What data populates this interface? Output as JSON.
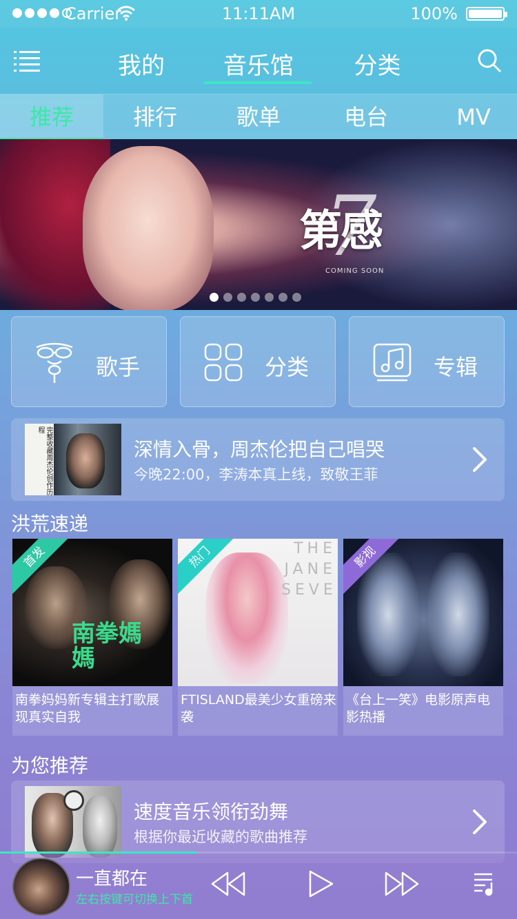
{
  "status_bar": {
    "carrier": "Carrier",
    "time": "11:11AM",
    "battery": "100%"
  },
  "top_nav": {
    "tabs": [
      "我的",
      "音乐馆",
      "分类"
    ],
    "active": 1
  },
  "sub_tabs": {
    "tabs": [
      "推荐",
      "排行",
      "歌单",
      "电台",
      "MV"
    ],
    "active": 0
  },
  "banner": {
    "title": "第7感",
    "title_text": "第感",
    "seven": "7",
    "subtitle": "COMING SOON",
    "pages": 7,
    "current_page": 0
  },
  "quick_links": [
    {
      "label": "歌手",
      "icon": "singer-icon"
    },
    {
      "label": "分类",
      "icon": "category-grid-icon"
    },
    {
      "label": "专辑",
      "icon": "album-icon"
    }
  ],
  "promo": {
    "title": "深情入骨，周杰伦把自己唱哭",
    "desc": "今晚22:00，李涛本真上线，致敬王菲",
    "cover_text": "完整收藏周杰伦创作历程"
  },
  "express": {
    "title": "洪荒速递",
    "items": [
      {
        "badge": "首发",
        "badge_color": "#2cc9a4",
        "caption": "南拳妈妈新专辑主打歌展现真实自我",
        "art_text": "南拳媽媽"
      },
      {
        "badge": "热门",
        "badge_color": "#2ad0c8",
        "caption": "FTISLAND最美少女重磅来袭",
        "art_text": "THE JANE SEVENTH"
      },
      {
        "badge": "影视",
        "badge_color": "#8e6ad8",
        "caption": "《台上一笑》电影原声电影热播",
        "art_text": ""
      }
    ]
  },
  "recommend": {
    "title": "为您推荐",
    "item": {
      "title": "速度音乐领衔劲舞",
      "desc": "根据你最近收藏的歌曲推荐"
    }
  },
  "player": {
    "song": "一直都在",
    "hint": "左右按键可切换上下首",
    "progress": 0.38
  },
  "colors": {
    "accent": "#3ee6c3",
    "accent_green": "#3ee6a8"
  }
}
